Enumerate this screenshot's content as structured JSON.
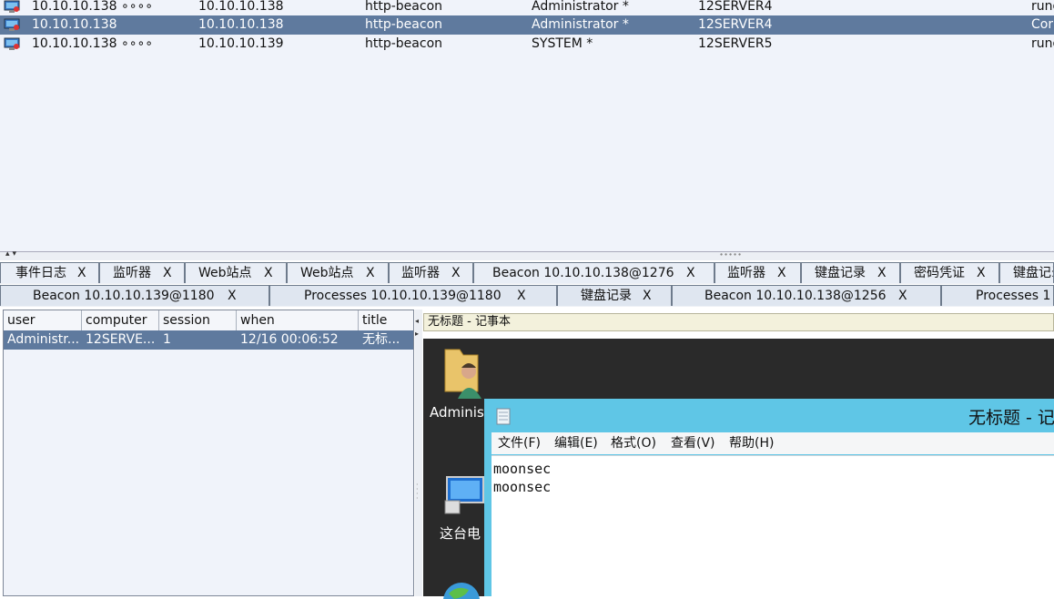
{
  "sessions": {
    "rows": [
      {
        "external": "10.10.10.138 ∘∘∘∘",
        "internal": "10.10.10.138",
        "listener": "http-beacon",
        "user": "Administrator *",
        "computer": "12SERVER4",
        "process": "rund",
        "selected": false
      },
      {
        "external": "10.10.10.138",
        "internal": "10.10.10.138",
        "listener": "http-beacon",
        "user": "Administrator *",
        "computer": "12SERVER4",
        "process": "Cor",
        "selected": true
      },
      {
        "external": "10.10.10.138 ∘∘∘∘",
        "internal": "10.10.10.139",
        "listener": "http-beacon",
        "user": "SYSTEM *",
        "computer": "12SERVER5",
        "process": "rund",
        "selected": false
      }
    ]
  },
  "tabs_row1": [
    {
      "label": "事件日志",
      "close": "X"
    },
    {
      "label": "监听器",
      "close": "X"
    },
    {
      "label": "Web站点",
      "close": "X"
    },
    {
      "label": "Web站点",
      "close": "X"
    },
    {
      "label": "监听器",
      "close": "X"
    },
    {
      "label": "Beacon 10.10.10.138@1276",
      "close": "X"
    },
    {
      "label": "监听器",
      "close": "X"
    },
    {
      "label": "键盘记录",
      "close": "X"
    },
    {
      "label": "密码凭证",
      "close": "X"
    },
    {
      "label": "键盘记录",
      "close": ""
    }
  ],
  "tabs_row2": [
    {
      "label": "Beacon 10.10.10.139@1180",
      "close": "X"
    },
    {
      "label": "Processes 10.10.10.139@1180",
      "close": "X"
    },
    {
      "label": "键盘记录",
      "close": "X"
    },
    {
      "label": "Beacon 10.10.10.138@1256",
      "close": "X"
    },
    {
      "label": "Processes 1",
      "close": ""
    }
  ],
  "keylog": {
    "columns": [
      "user",
      "computer",
      "session",
      "when",
      "title"
    ],
    "rows": [
      {
        "user": "Administr...",
        "computer": "12SERVE...",
        "session": "1",
        "when": "12/16 00:06:52",
        "title": "无标..."
      }
    ]
  },
  "screenshot": {
    "title": "无标题 - 记事本",
    "desktop_icons": [
      "Adminis",
      "这台电"
    ],
    "notepad": {
      "title": "无标题 - 记",
      "menu": [
        "文件(F)",
        "编辑(E)",
        "格式(O)",
        "查看(V)",
        "帮助(H)"
      ],
      "lines": [
        "moonsec",
        "moonsec"
      ]
    }
  },
  "colors": {
    "selected_row": "#5f7a9e",
    "panel_bg": "#f0f3fa",
    "notepad_title": "#5fc6e6"
  },
  "icons": [
    "monitor-icon",
    "folder-user-icon",
    "computer-icon",
    "globe-icon",
    "notepad-icon"
  ]
}
